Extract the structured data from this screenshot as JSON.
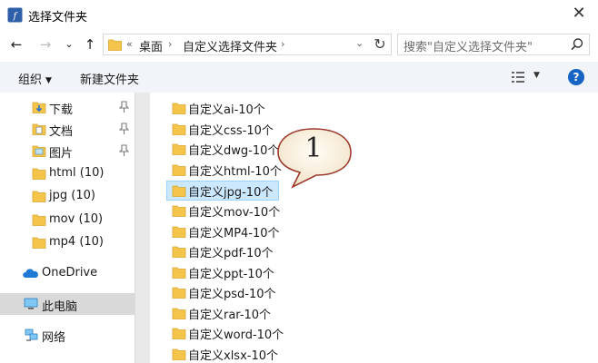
{
  "window": {
    "title": "选择文件夹"
  },
  "nav_buttons": {
    "back": "←",
    "forward": "→",
    "recent": "⌄",
    "up": "↑"
  },
  "address": {
    "overflow": "«",
    "crumbs": [
      "桌面",
      "自定义选择文件夹"
    ],
    "separator": "›",
    "dropdown": "⌄",
    "refresh": "↻"
  },
  "search": {
    "placeholder": "搜索\"自定义选择文件夹\""
  },
  "toolbar": {
    "organize": "组织",
    "organize_caret": "▼",
    "new_folder": "新建文件夹",
    "view_caret": "▼",
    "help": "?"
  },
  "nav": {
    "items": [
      {
        "label": "下载",
        "icon": "download-folder-icon",
        "pinned": true
      },
      {
        "label": "文档",
        "icon": "documents-folder-icon",
        "pinned": true
      },
      {
        "label": "图片",
        "icon": "pictures-folder-icon",
        "pinned": true
      },
      {
        "label": "html (10)",
        "icon": "folder-icon",
        "pinned": false
      },
      {
        "label": "jpg (10)",
        "icon": "folder-icon",
        "pinned": false
      },
      {
        "label": "mov (10)",
        "icon": "folder-icon",
        "pinned": false
      },
      {
        "label": "mp4 (10)",
        "icon": "folder-icon",
        "pinned": false
      },
      {
        "label": "OneDrive",
        "icon": "onedrive-cloud-icon",
        "pinned": false
      },
      {
        "label": "此电脑",
        "icon": "this-pc-icon",
        "pinned": false,
        "selected": true
      },
      {
        "label": "网络",
        "icon": "network-icon",
        "pinned": false
      }
    ]
  },
  "files": {
    "items": [
      {
        "label": "自定义ai-10个"
      },
      {
        "label": "自定义css-10个"
      },
      {
        "label": "自定义dwg-10个"
      },
      {
        "label": "自定义html-10个"
      },
      {
        "label": "自定义jpg-10个",
        "selected": true
      },
      {
        "label": "自定义mov-10个"
      },
      {
        "label": "自定义MP4-10个"
      },
      {
        "label": "自定义pdf-10个"
      },
      {
        "label": "自定义ppt-10个"
      },
      {
        "label": "自定义psd-10个"
      },
      {
        "label": "自定义rar-10个"
      },
      {
        "label": "自定义word-10个"
      },
      {
        "label": "自定义xlsx-10个"
      }
    ]
  },
  "callout": {
    "text": "1"
  },
  "colors": {
    "accent": "#1764c4",
    "folder": "#f4c54a",
    "selection": "#cce8ff"
  }
}
